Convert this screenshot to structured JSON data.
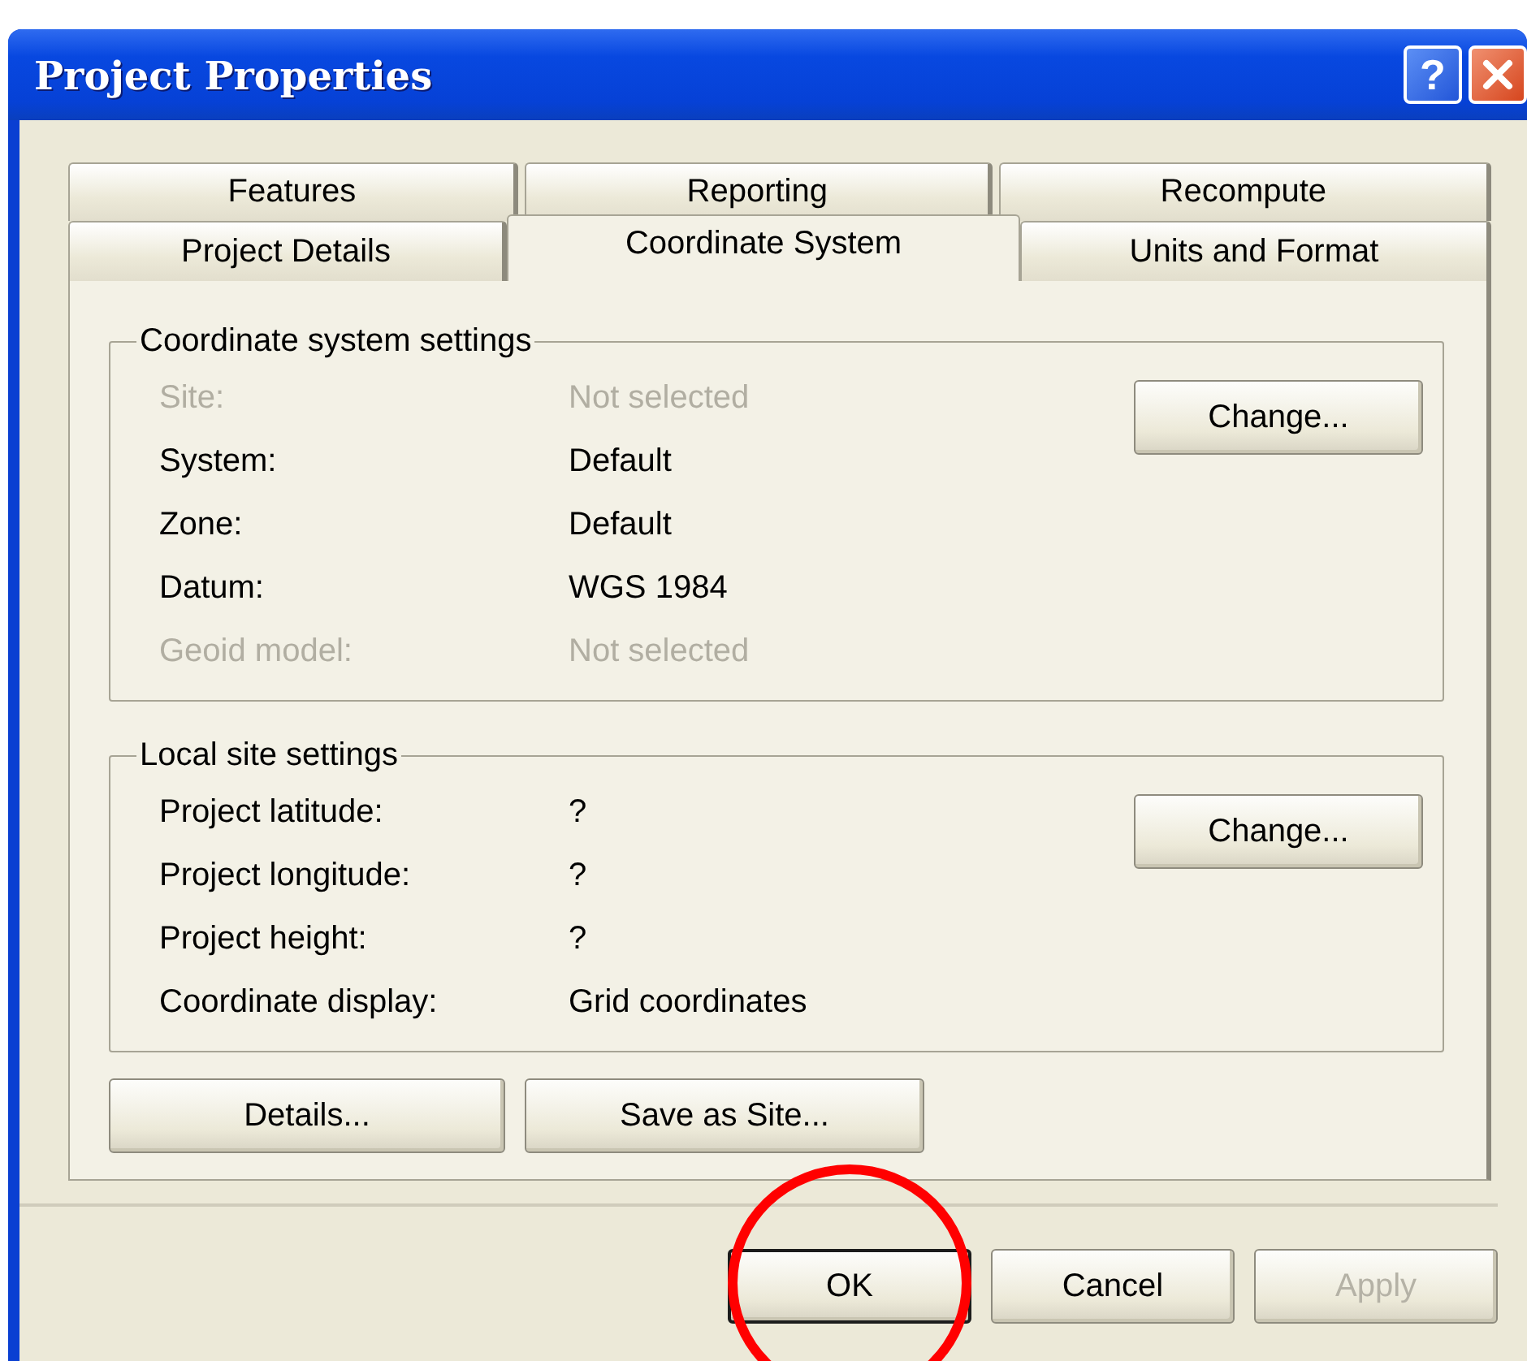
{
  "window": {
    "title": "Project Properties",
    "help_button": "?"
  },
  "tabs": [
    [
      {
        "label": "Features",
        "selected": false
      },
      {
        "label": "Reporting",
        "selected": false
      },
      {
        "label": "Recompute",
        "selected": false
      }
    ],
    [
      {
        "label": "Project Details",
        "selected": false
      },
      {
        "label": "Coordinate System",
        "selected": true
      },
      {
        "label": "Units and Format",
        "selected": false
      }
    ]
  ],
  "groups": [
    {
      "title": "Coordinate system settings",
      "button": "Change...",
      "rows": [
        {
          "label": "Site:",
          "value": "Not selected",
          "disabled": true
        },
        {
          "label": "System:",
          "value": "Default",
          "disabled": false
        },
        {
          "label": "Zone:",
          "value": "Default",
          "disabled": false
        },
        {
          "label": "Datum:",
          "value": "WGS 1984",
          "disabled": false
        },
        {
          "label": "Geoid model:",
          "value": "Not selected",
          "disabled": true
        }
      ]
    },
    {
      "title": "Local site settings",
      "button": "Change...",
      "rows": [
        {
          "label": "Project latitude:",
          "value": "?",
          "disabled": false
        },
        {
          "label": "Project longitude:",
          "value": "?",
          "disabled": false
        },
        {
          "label": "Project height:",
          "value": "?",
          "disabled": false
        },
        {
          "label": "Coordinate display:",
          "value": "Grid coordinates",
          "disabled": false
        }
      ]
    }
  ],
  "panel_buttons": [
    "Details...",
    "Save as Site..."
  ],
  "dialog_buttons": [
    {
      "label": "OK",
      "default": true,
      "disabled": false,
      "circled": true
    },
    {
      "label": "Cancel",
      "default": false,
      "disabled": false,
      "circled": false
    },
    {
      "label": "Apply",
      "default": false,
      "disabled": true,
      "circled": false
    }
  ]
}
